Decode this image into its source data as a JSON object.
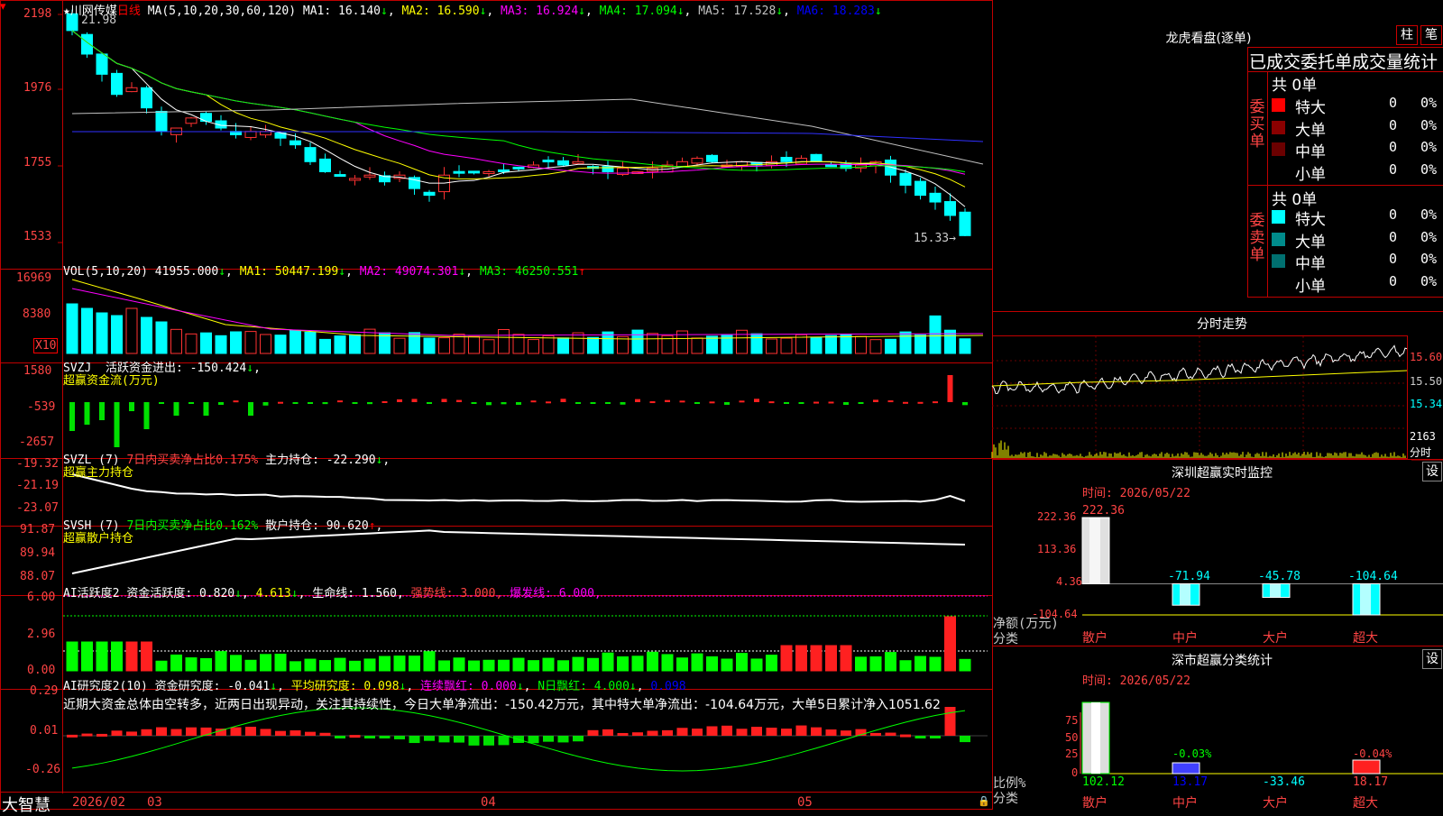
{
  "app": {
    "brand": "大智慧"
  },
  "stock": {
    "name": "川网传媒",
    "period": "日线",
    "star": "★",
    "first_bar_label": "21.98",
    "last_price_label": "15.33"
  },
  "price_panel": {
    "ticks": [
      "2198",
      "1976",
      "1755",
      "1533"
    ],
    "ma_title": "MA(5,10,20,30,60,120)",
    "ma": [
      {
        "label": "MA1:",
        "value": "16.140",
        "arrow": "↓",
        "color": "#ffffff"
      },
      {
        "label": "MA2:",
        "value": "16.590",
        "arrow": "↓",
        "color": "#ffff00"
      },
      {
        "label": "MA3:",
        "value": "16.924",
        "arrow": "↓",
        "color": "#ff00ff"
      },
      {
        "label": "MA4:",
        "value": "17.094",
        "arrow": "↓",
        "color": "#00ff00"
      },
      {
        "label": "MA5:",
        "value": "17.528",
        "arrow": "↓",
        "color": "#c0c0c0"
      },
      {
        "label": "MA6:",
        "value": "18.283",
        "arrow": "↓",
        "color": "#0000ff"
      }
    ]
  },
  "vol_panel": {
    "title": "VOL(5,10,20)",
    "value": "41955.000",
    "arrow": "↓",
    "ma": [
      {
        "label": "MA1:",
        "value": "50447.199",
        "arrow": "↓",
        "color": "#ffff00"
      },
      {
        "label": "MA2:",
        "value": "49074.301",
        "arrow": "↓",
        "color": "#ff00ff"
      },
      {
        "label": "MA3:",
        "value": "46250.551",
        "arrow": "↑",
        "color": "#00ff00"
      }
    ],
    "ticks": [
      "16969",
      "8380"
    ],
    "unit": "X10"
  },
  "svzj_panel": {
    "title": "SVZJ",
    "label": "活跃资金进出:",
    "value": "-150.424",
    "arrow": "↓",
    "sub": "超赢资金流(万元)",
    "ticks": [
      "1580",
      "-539",
      "-2657"
    ]
  },
  "svzl_panel": {
    "title": "SVZL (7)",
    "ratio_label": "7日内买卖净占比0.175%",
    "label": "主力持仓:",
    "value": "-22.290",
    "arrow": "↓",
    "sub": "超赢主力持仓",
    "ticks": [
      "-19.32",
      "-21.19",
      "-23.07"
    ]
  },
  "svsh_panel": {
    "title": "SVSH (7)",
    "ratio_label": "7日内买卖净占比0.162%",
    "label": "散户持仓:",
    "value": "90.620",
    "arrow": "↑",
    "sub": "超赢散户持仓",
    "ticks": [
      "91.87",
      "89.94",
      "88.07"
    ]
  },
  "ai_active": {
    "title": "AI活跃度2",
    "label": "资金活跃度:",
    "v1": "0.820",
    "a1": "↓",
    "v2": "4.613",
    "a2": "↓",
    "life_label": "生命线:",
    "life": "1.560",
    "strong_label": "强势线:",
    "strong": "3.000",
    "burst_label": "爆发线:",
    "burst": "6.000",
    "ticks": [
      "6.00",
      "2.96",
      "0.00"
    ]
  },
  "ai_research": {
    "title": "AI研究度2(10)",
    "label": "资金研究度:",
    "value": "-0.041",
    "arrow": "↓",
    "avg_label": "平均研究度:",
    "avg": "0.098",
    "avg_arrow": "↓",
    "red_label": "连续飘红:",
    "red": "0.000",
    "red_arrow": "↓",
    "nred_label": "N日飘红:",
    "nred": "4.000",
    "nred_arrow": "↓",
    "extra": "0.098",
    "commentary": "近期大资金总体由空转多，近两日出现异动，关注其持续性，今日大单净流出：-150.42万元，其中特大单净流出：-104.64万元，大单5日累计净入1051.62",
    "ticks": [
      "0.29",
      "0.01",
      "-0.26"
    ]
  },
  "dates": {
    "d1": "2026/02",
    "m3": "03",
    "m4": "04",
    "m5": "05"
  },
  "lhb": {
    "title": "龙虎看盘(逐单)",
    "btn_zhu": "柱",
    "btn_bi": "笔",
    "header": "已成交委托单成交量统计",
    "buy": {
      "total": "共 0单",
      "side": "委买单",
      "rows": [
        {
          "name": "特大",
          "count": "0",
          "pct": "0%",
          "color": "#ff0000"
        },
        {
          "name": "大单",
          "count": "0",
          "pct": "0%",
          "color": "#8b0000"
        },
        {
          "name": "中单",
          "count": "0",
          "pct": "0%",
          "color": "#6b0000"
        },
        {
          "name": "小单",
          "count": "0",
          "pct": "0%",
          "color": "#000000"
        }
      ]
    },
    "sell": {
      "total": "共 0单",
      "side": "委卖单",
      "rows": [
        {
          "name": "特大",
          "count": "0",
          "pct": "0%",
          "color": "#00ffff"
        },
        {
          "name": "大单",
          "count": "0",
          "pct": "0%",
          "color": "#008b8b"
        },
        {
          "name": "中单",
          "count": "0",
          "pct": "0%",
          "color": "#007070"
        },
        {
          "name": "小单",
          "count": "0",
          "pct": "0%",
          "color": "#000000"
        }
      ]
    }
  },
  "intraday": {
    "title": "分时走势",
    "p1": "15.60",
    "p2": "15.50",
    "p3": "15.34",
    "vol": "2163",
    "vol_label": "分时"
  },
  "monitor": {
    "title": "深圳超赢实时监控",
    "btn": "设",
    "time_label": "时间: 2026/05/22",
    "ticks": [
      "222.36",
      "113.36",
      "4.36",
      "-104.64"
    ],
    "unit_label": "净额(万元)",
    "class_label": "分类",
    "values": [
      {
        "name": "散户",
        "val": 222.36,
        "text": "222.36"
      },
      {
        "name": "中户",
        "val": -71.94,
        "text": "-71.94"
      },
      {
        "name": "大户",
        "val": -45.78,
        "text": "-45.78"
      },
      {
        "name": "超大",
        "val": -104.64,
        "text": "-104.64"
      }
    ]
  },
  "classify": {
    "title": "深市超赢分类统计",
    "btn": "设",
    "time_label": "时间: 2026/05/22",
    "ticks": [
      "75",
      "50",
      "25",
      "0"
    ],
    "ratio_label": "比例%",
    "class_label": "分类",
    "values": [
      {
        "name": "散户",
        "val": "102.12",
        "pct": ""
      },
      {
        "name": "中户",
        "val": "13.17",
        "pct": "-0.03%"
      },
      {
        "name": "大户",
        "val": "-33.46",
        "pct": ""
      },
      {
        "name": "超大",
        "val": "18.17",
        "pct": "-0.04%"
      }
    ]
  },
  "chart_data": {
    "type": "bar",
    "categories": [
      "散户",
      "中户",
      "大户",
      "超大"
    ],
    "values": [
      222.36,
      -71.94,
      -45.78,
      -104.64
    ],
    "ylabel": "净额(万元)",
    "ylim": [
      -104.64,
      222.36
    ]
  }
}
